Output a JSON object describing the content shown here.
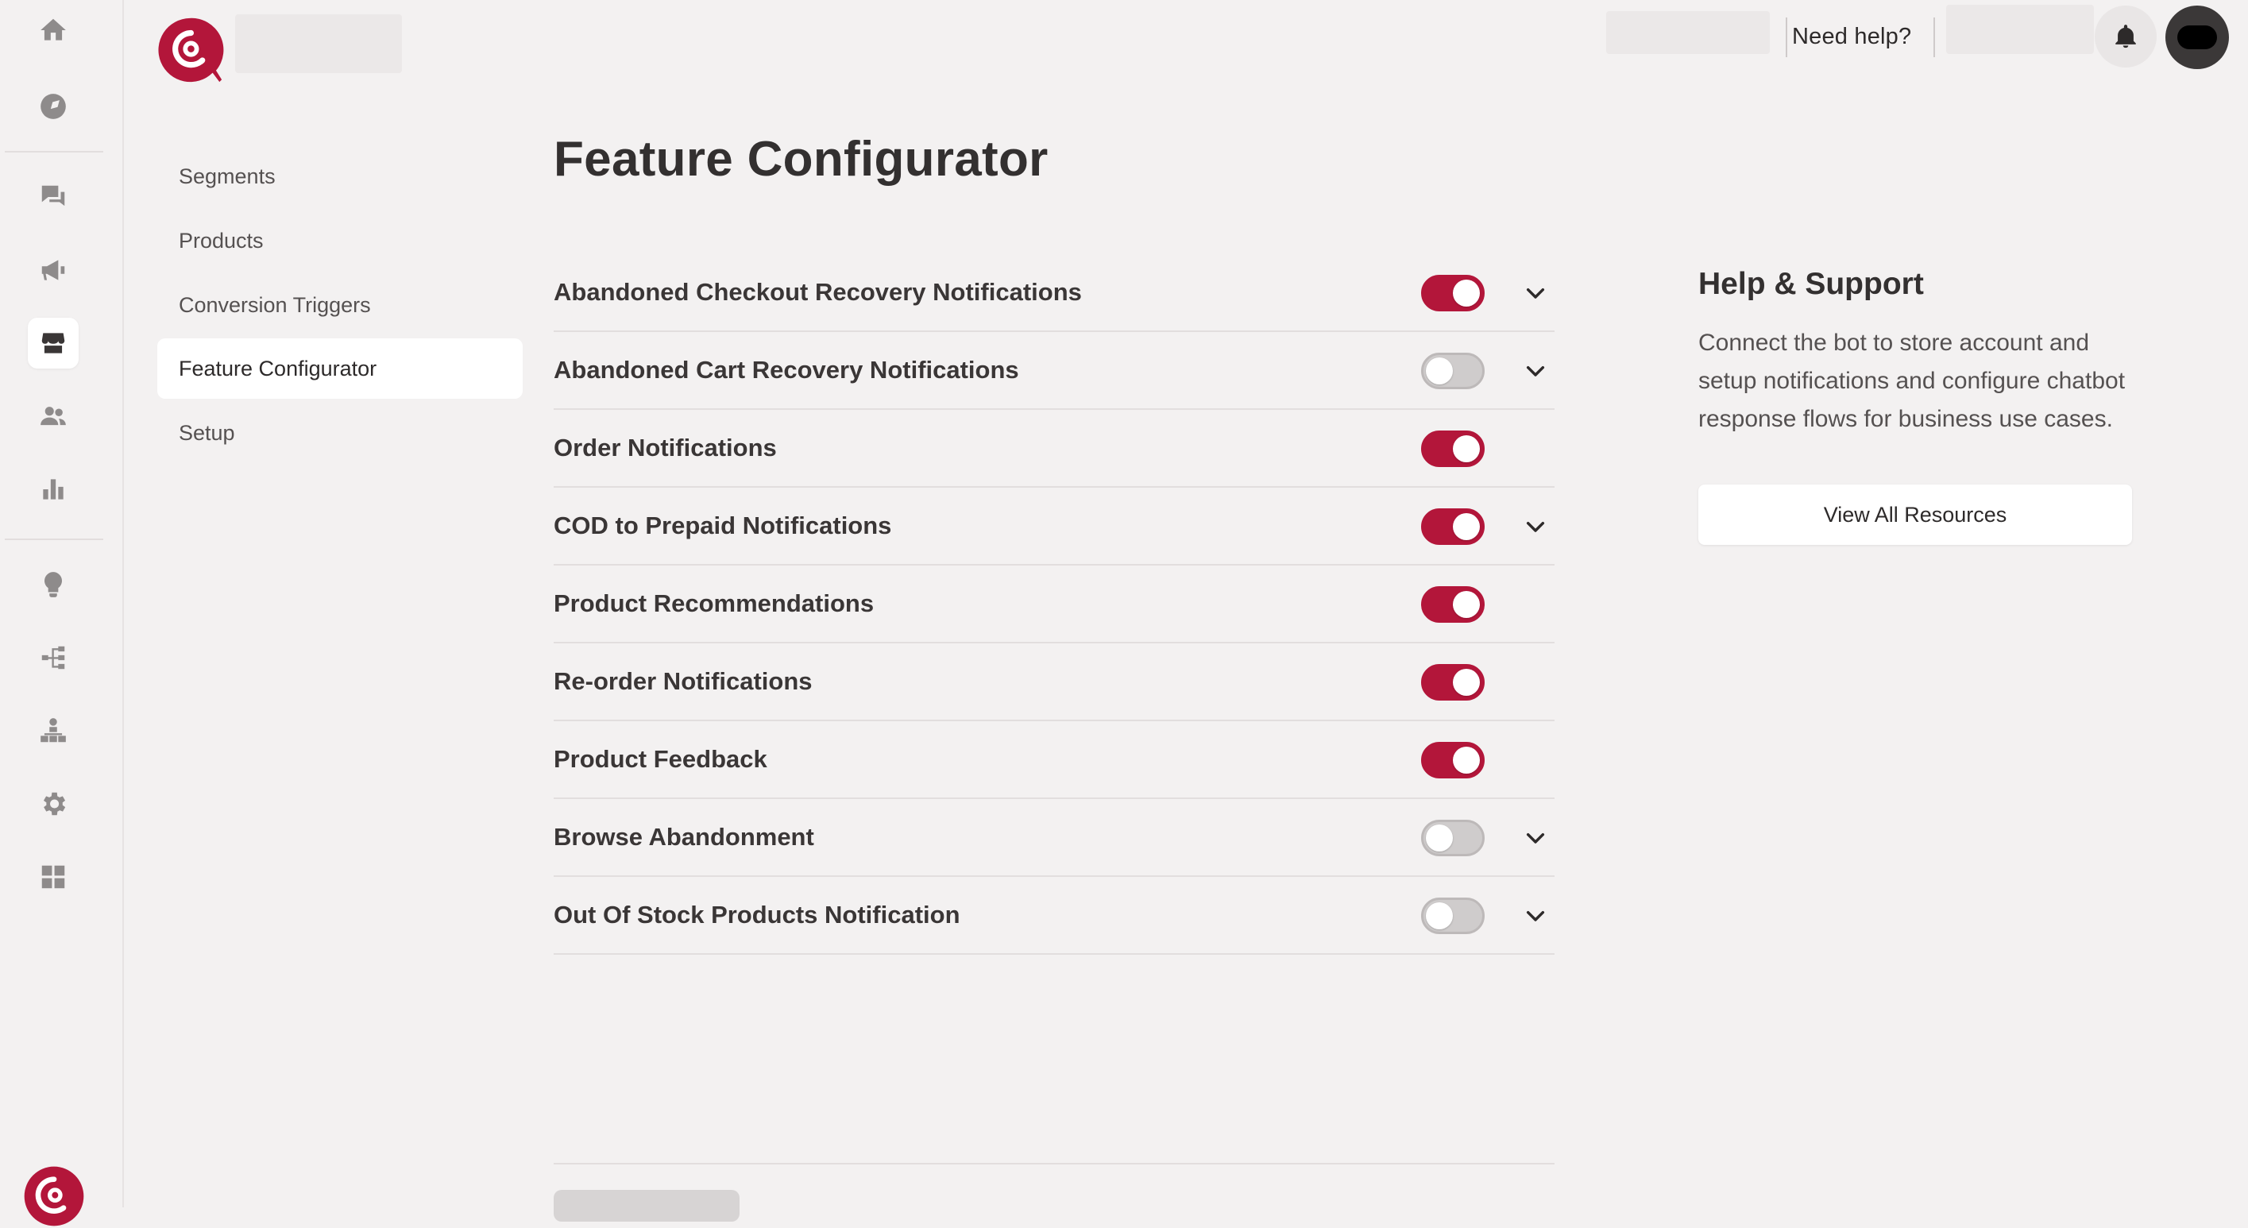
{
  "rail": {
    "items": [
      {
        "icon": "home-icon"
      },
      {
        "icon": "compass-icon"
      },
      {
        "icon": "chat-icon"
      },
      {
        "icon": "megaphone-icon"
      },
      {
        "icon": "store-icon",
        "active": true
      },
      {
        "icon": "users-icon"
      },
      {
        "icon": "bar-chart-icon"
      },
      {
        "icon": "lightbulb-icon"
      },
      {
        "icon": "flow-icon"
      },
      {
        "icon": "org-chart-icon"
      },
      {
        "icon": "gear-icon"
      },
      {
        "icon": "integrations-icon"
      }
    ]
  },
  "topbar": {
    "help_label": "Need help?"
  },
  "subnav": {
    "items": [
      {
        "label": "Segments"
      },
      {
        "label": "Products"
      },
      {
        "label": "Conversion Triggers"
      },
      {
        "label": "Feature Configurator",
        "active": true
      },
      {
        "label": "Setup"
      }
    ]
  },
  "main": {
    "title": "Feature Configurator",
    "features": [
      {
        "label": "Abandoned Checkout Recovery Notifications",
        "enabled": true,
        "expandable": true
      },
      {
        "label": "Abandoned Cart Recovery Notifications",
        "enabled": false,
        "expandable": true
      },
      {
        "label": "Order Notifications",
        "enabled": true,
        "expandable": false
      },
      {
        "label": "COD to Prepaid Notifications",
        "enabled": true,
        "expandable": true
      },
      {
        "label": "Product Recommendations",
        "enabled": true,
        "expandable": false
      },
      {
        "label": "Re-order Notifications",
        "enabled": true,
        "expandable": false
      },
      {
        "label": "Product Feedback",
        "enabled": true,
        "expandable": false
      },
      {
        "label": "Browse Abandonment",
        "enabled": false,
        "expandable": true
      },
      {
        "label": "Out Of Stock Products Notification",
        "enabled": false,
        "expandable": true
      }
    ]
  },
  "help_panel": {
    "title": "Help & Support",
    "description": "Connect the bot to store account and setup notifications and configure chatbot response flows for business use cases.",
    "button_label": "View All Resources"
  },
  "colors": {
    "accent": "#b3163a",
    "toggle_off": "#cfcccc",
    "background": "#f3f1f1"
  }
}
